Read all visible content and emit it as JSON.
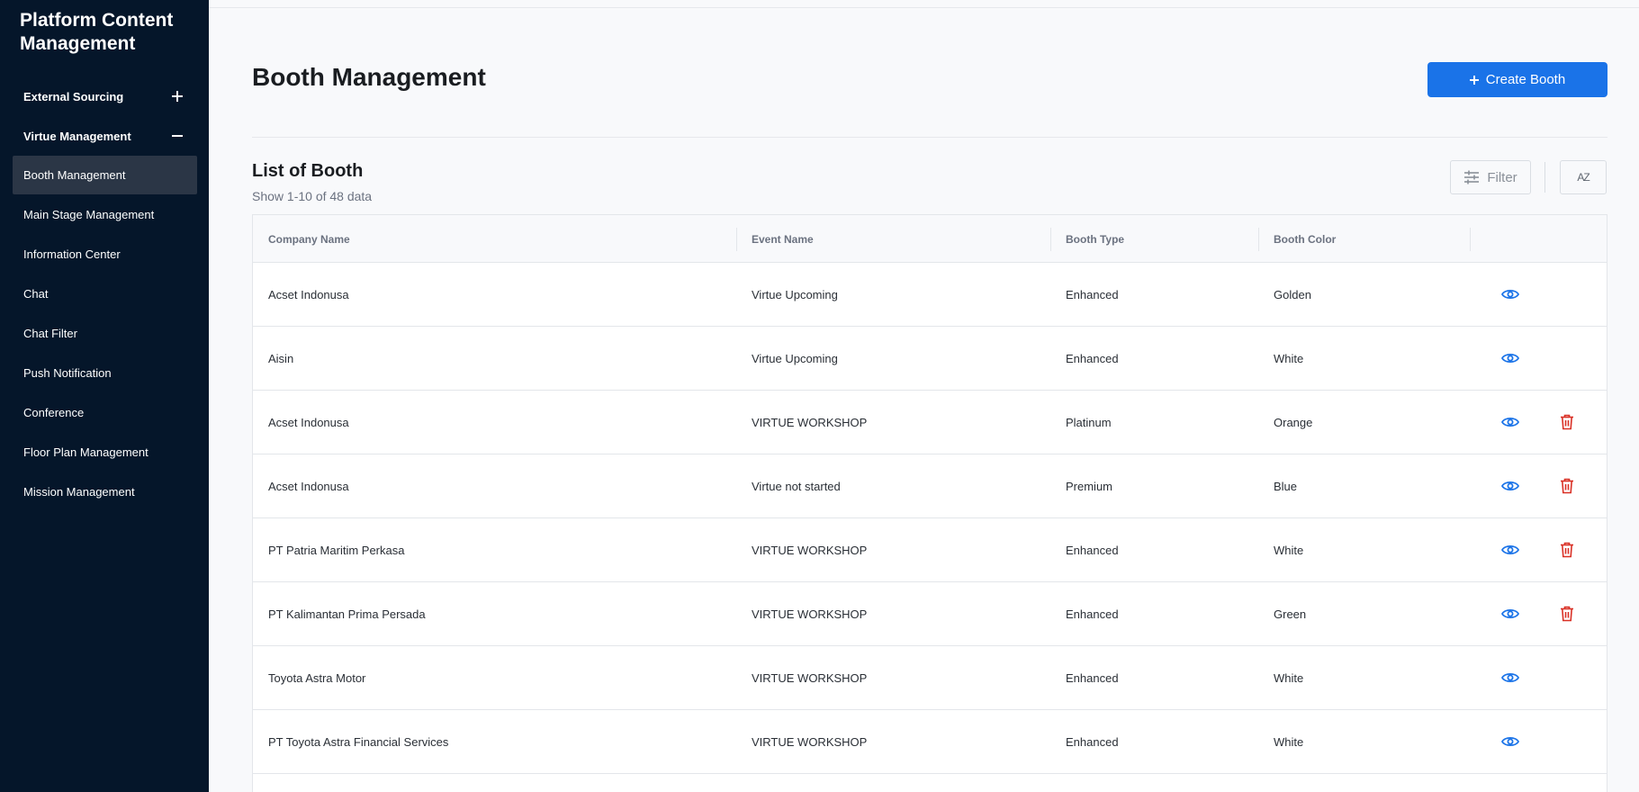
{
  "app": {
    "title": "Platform Content Management"
  },
  "sidebar": {
    "groups": [
      {
        "label": "External Sourcing",
        "expanded": false
      },
      {
        "label": "Virtue Management",
        "expanded": true
      }
    ],
    "items": [
      {
        "label": "Booth Management",
        "active": true
      },
      {
        "label": "Main Stage Management"
      },
      {
        "label": "Information Center"
      },
      {
        "label": "Chat"
      },
      {
        "label": "Chat Filter"
      },
      {
        "label": "Push Notification"
      },
      {
        "label": "Conference"
      },
      {
        "label": "Floor Plan Management"
      },
      {
        "label": "Mission Management"
      }
    ]
  },
  "header": {
    "title": "Booth Management",
    "create_label": "Create Booth"
  },
  "list": {
    "title": "List of Booth",
    "subtitle": "Show 1-10 of 48 data",
    "filter_label": "Filter",
    "sort_label": "AZ"
  },
  "table": {
    "columns": [
      "Company Name",
      "Event Name",
      "Booth Type",
      "Booth Color"
    ],
    "rows": [
      {
        "company": "Acset Indonusa",
        "event": "Virtue Upcoming",
        "type": "Enhanced",
        "color": "Golden",
        "deletable": false
      },
      {
        "company": "Aisin",
        "event": "Virtue Upcoming",
        "type": "Enhanced",
        "color": "White",
        "deletable": false
      },
      {
        "company": "Acset Indonusa",
        "event": "VIRTUE WORKSHOP",
        "type": "Platinum",
        "color": "Orange",
        "deletable": true
      },
      {
        "company": "Acset Indonusa",
        "event": "Virtue not started",
        "type": "Premium",
        "color": "Blue",
        "deletable": true
      },
      {
        "company": "PT Patria Maritim Perkasa",
        "event": "VIRTUE WORKSHOP",
        "type": "Enhanced",
        "color": "White",
        "deletable": true
      },
      {
        "company": "PT Kalimantan Prima Persada",
        "event": "VIRTUE WORKSHOP",
        "type": "Enhanced",
        "color": "Green",
        "deletable": true
      },
      {
        "company": "Toyota Astra Motor",
        "event": "VIRTUE WORKSHOP",
        "type": "Enhanced",
        "color": "White",
        "deletable": false
      },
      {
        "company": "PT Toyota Astra Financial Services",
        "event": "VIRTUE WORKSHOP",
        "type": "Enhanced",
        "color": "White",
        "deletable": false
      }
    ]
  },
  "colors": {
    "sidebar_bg": "#05162a",
    "primary": "#1a73e8",
    "danger": "#d93025",
    "view_icon": "#1a73e8"
  },
  "icons": {
    "view": "eye-icon",
    "delete": "trash-icon",
    "filter": "sliders-icon",
    "sort": "sort-az-icon",
    "expand": "plus-icon",
    "collapse": "minus-icon",
    "create": "plus-icon"
  }
}
